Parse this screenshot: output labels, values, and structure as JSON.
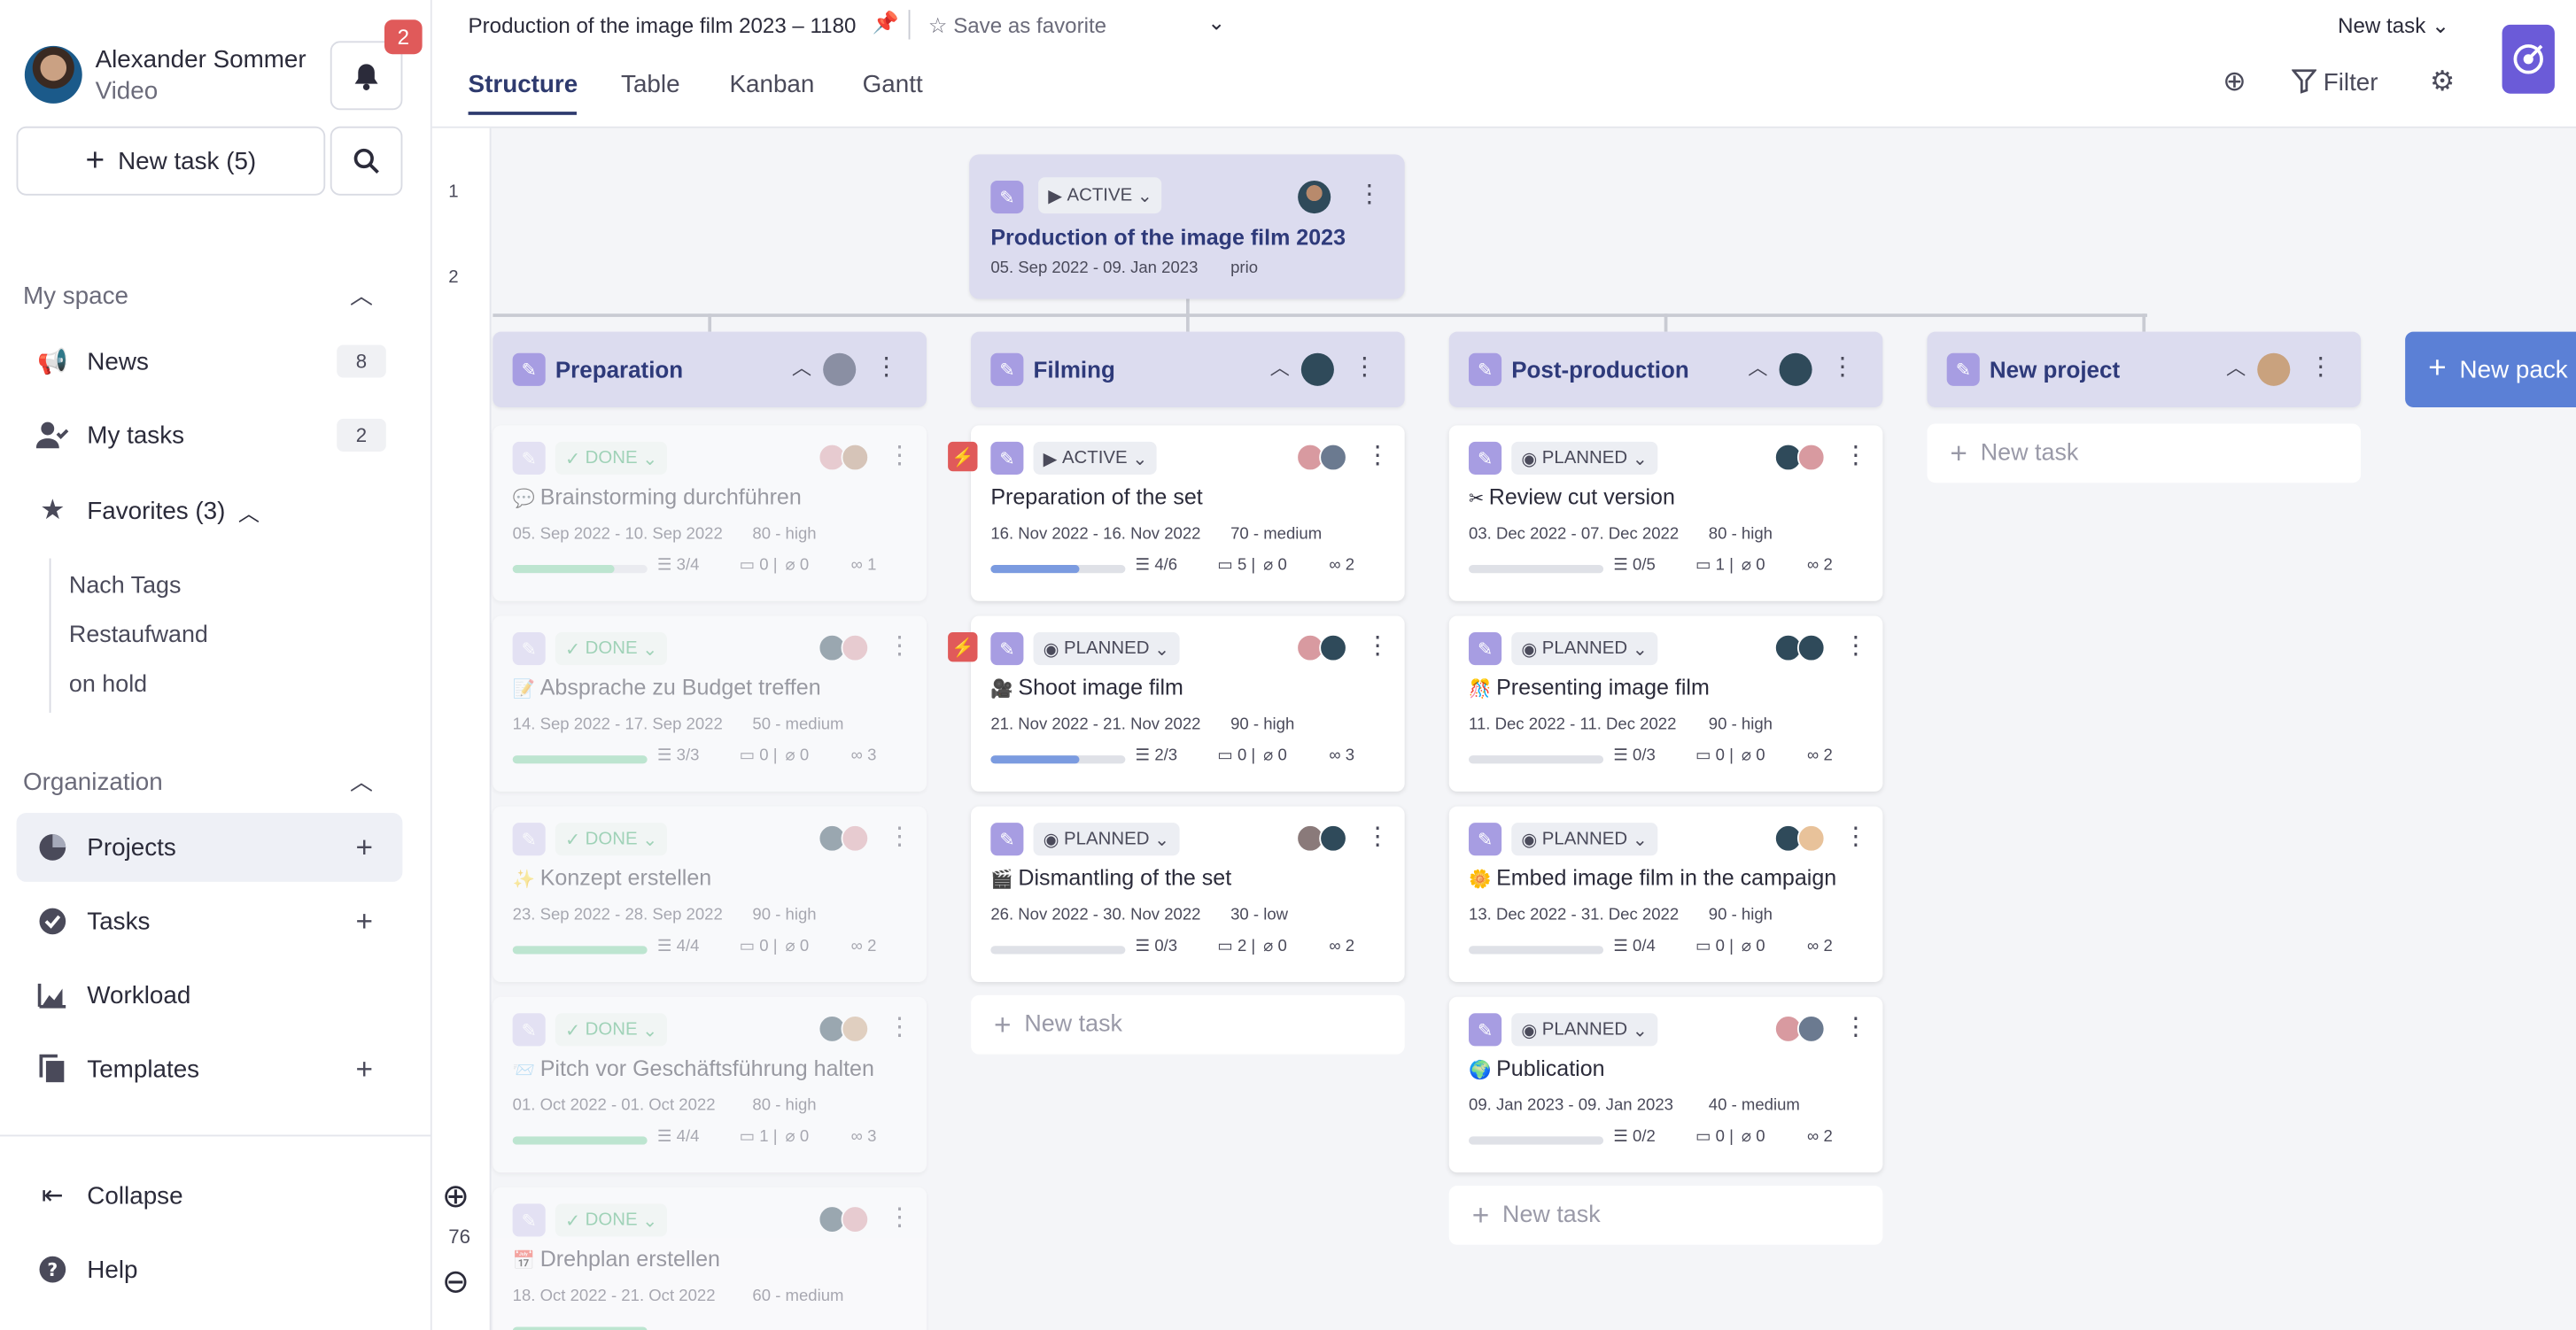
{
  "user": {
    "name": "Alexander Sommer",
    "role": "Video",
    "notifications": "2"
  },
  "sidebar": {
    "new_task": "New task (5)",
    "my_space": "My space",
    "news": "News",
    "news_count": "8",
    "my_tasks": "My tasks",
    "my_tasks_count": "2",
    "favorites": "Favorites (3)",
    "fav_items": [
      "Nach Tags",
      "Restaufwand",
      "on hold"
    ],
    "organization": "Organization",
    "projects": "Projects",
    "tasks": "Tasks",
    "workload": "Workload",
    "templates": "Templates",
    "collapse": "Collapse",
    "help": "Help"
  },
  "topbar": {
    "title": "Production of the image film 2023 – 1180",
    "save_favorite": "Save as favorite",
    "tabs": [
      "Structure",
      "Table",
      "Kanban",
      "Gantt"
    ],
    "new_task": "New task",
    "filter": "Filter"
  },
  "canvas": {
    "rows": [
      "1",
      "2"
    ],
    "zoom": "76",
    "root": {
      "status": "ACTIVE",
      "title": "Production of the image film 2023",
      "dates": "05. Sep 2022 - 09. Jan 2023",
      "prio": "prio"
    },
    "phases": [
      "Preparation",
      "Filming",
      "Post-production",
      "New project"
    ],
    "new_package": "New pack",
    "add_task": "New task"
  },
  "cards": [
    {
      "status": "DONE",
      "title": "Brainstorming durchführen",
      "dates": "05. Sep 2022 - 10. Sep 2022",
      "prio": "80 - high",
      "checklist": "3/4",
      "comments": "0",
      "attach": "0",
      "links": "1",
      "progress": 0.75
    },
    {
      "status": "DONE",
      "title": "Absprache zu Budget treffen",
      "dates": "14. Sep 2022 - 17. Sep 2022",
      "prio": "50 - medium",
      "checklist": "3/3",
      "comments": "0",
      "attach": "0",
      "links": "3",
      "progress": 1
    },
    {
      "status": "DONE",
      "title": "Konzept erstellen",
      "dates": "23. Sep 2022 - 28. Sep 2022",
      "prio": "90 - high",
      "checklist": "4/4",
      "comments": "0",
      "attach": "0",
      "links": "2",
      "progress": 1
    },
    {
      "status": "DONE",
      "title": "Pitch vor Geschäftsführung halten",
      "dates": "01. Oct 2022 - 01. Oct 2022",
      "prio": "80 - high",
      "checklist": "4/4",
      "comments": "1",
      "attach": "0",
      "links": "3",
      "progress": 1
    },
    {
      "status": "DONE",
      "title": "Drehplan erstellen",
      "dates": "18. Oct 2022 - 21. Oct 2022",
      "prio": "60 - medium",
      "checklist": "",
      "comments": "",
      "attach": "",
      "links": "",
      "progress": 1
    },
    {
      "status": "ACTIVE",
      "title": "Preparation of the set",
      "dates": "16. Nov 2022 - 16. Nov 2022",
      "prio": "70 - medium",
      "checklist": "4/6",
      "comments": "5",
      "attach": "0",
      "links": "2",
      "progress": 0.66
    },
    {
      "status": "PLANNED",
      "title": "Shoot image film",
      "dates": "21. Nov 2022 - 21. Nov 2022",
      "prio": "90 - high",
      "checklist": "2/3",
      "comments": "0",
      "attach": "0",
      "links": "3",
      "progress": 0.66
    },
    {
      "status": "PLANNED",
      "title": "Dismantling of the set",
      "dates": "26. Nov 2022 - 30. Nov 2022",
      "prio": "30 - low",
      "checklist": "0/3",
      "comments": "2",
      "attach": "0",
      "links": "2",
      "progress": 0
    },
    {
      "status": "PLANNED",
      "title": "Review cut version",
      "dates": "03. Dec 2022 - 07. Dec 2022",
      "prio": "80 - high",
      "checklist": "0/5",
      "comments": "1",
      "attach": "0",
      "links": "2",
      "progress": 0
    },
    {
      "status": "PLANNED",
      "title": "Presenting image film",
      "dates": "11. Dec 2022 - 11. Dec 2022",
      "prio": "90 - high",
      "checklist": "0/3",
      "comments": "0",
      "attach": "0",
      "links": "2",
      "progress": 0
    },
    {
      "status": "PLANNED",
      "title": "Embed image film in the campaign",
      "dates": "13. Dec 2022 - 31. Dec 2022",
      "prio": "90 - high",
      "checklist": "0/4",
      "comments": "0",
      "attach": "0",
      "links": "2",
      "progress": 0
    },
    {
      "status": "PLANNED",
      "title": "Publication",
      "dates": "09. Jan 2023 - 09. Jan 2023",
      "prio": "40 - medium",
      "checklist": "0/2",
      "comments": "0",
      "attach": "0",
      "links": "2",
      "progress": 0
    }
  ],
  "colors": {
    "accent": "#2e3a6e",
    "phase_bg": "#dcdcef",
    "done": "#3aa86a",
    "urgent": "#e05a5a",
    "logo": "#6b5bd8"
  }
}
